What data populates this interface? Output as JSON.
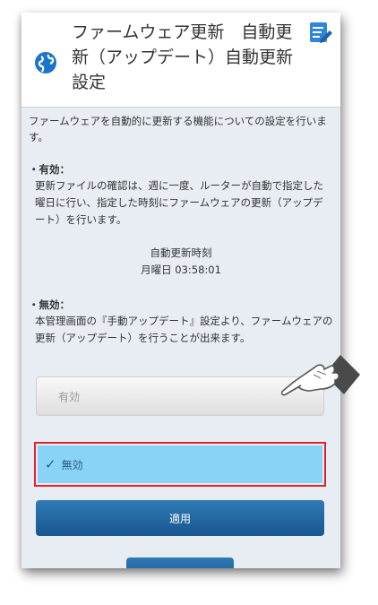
{
  "header": {
    "title": "ファームウェア更新　自動更新（アップデート）自動更新設定"
  },
  "content": {
    "intro": "ファームウェアを自動的に更新する機能についての設定を行います。",
    "enabled_heading": "・有効：",
    "enabled_desc": "更新ファイルの確認は、週に一度、ルーターが自動で指定した曜日に行い、指定した時刻にファームウェアの更新（アップデート）を行います。",
    "auto_update_time_label": "自動更新時刻",
    "auto_update_time_value": "月曜日 03:58:01",
    "disabled_heading": "・無効：",
    "disabled_desc": "本管理画面の『手動アップデート』設定より、ファームウェアの更新（アップデート）を行うことが出来ます。"
  },
  "options": {
    "enabled_label": "有効",
    "disabled_label": "無効",
    "selected": "無効",
    "check_mark": "✓"
  },
  "buttons": {
    "apply_label": "適用"
  },
  "colors": {
    "selected_bg": "#89d3f6",
    "highlight_border": "#e2232a",
    "button_blue": "#1f65a0"
  },
  "icons": {
    "globe": "globe-icon",
    "edit": "edit-list-icon",
    "pointer": "pointing-hand-icon"
  }
}
